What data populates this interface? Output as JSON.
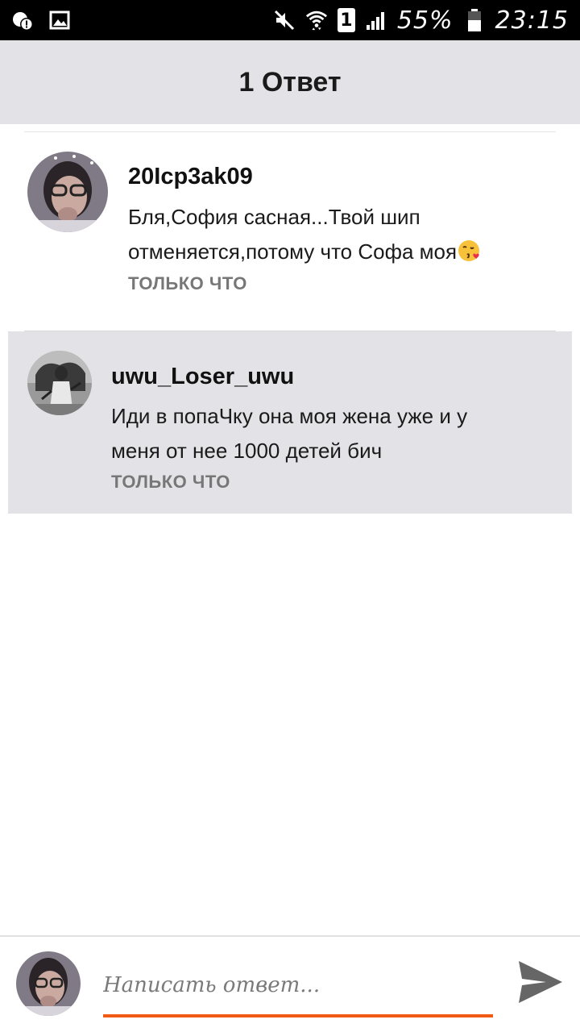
{
  "status_bar": {
    "battery_percent": "55%",
    "time": "23:15",
    "sim_slot": "1",
    "icons": [
      "alert-icon",
      "image-icon",
      "mute-icon",
      "wifi-icon",
      "sim-icon",
      "signal-icon",
      "battery-icon"
    ]
  },
  "header": {
    "title": "1 Ответ"
  },
  "comments": [
    {
      "username": "20Icp3ak09",
      "text": "Бля,София сасная...Твой шип отменяется,потому что Софа моя",
      "emoji": "kissing-face-emoji",
      "timestamp": "ТОЛЬКО ЧТО"
    },
    {
      "username": "uwu_Loser_uwu",
      "text": "Иди в попаЧку она моя жена уже и у меня от нее 1000 детей бич",
      "timestamp": "ТОЛЬКО ЧТО"
    }
  ],
  "reply_box": {
    "placeholder": "Написать ответ...",
    "value": ""
  },
  "colors": {
    "accent": "#f05a14",
    "header_bg": "#e3e2e6",
    "reply_bg": "#e3e2e6"
  }
}
